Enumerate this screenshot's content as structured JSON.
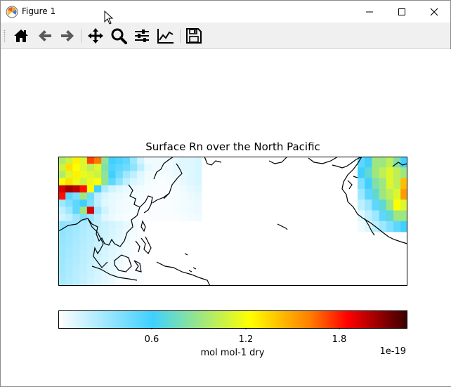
{
  "window": {
    "title": "Figure 1",
    "controls": {
      "minimize": "minimize",
      "maximize": "maximize",
      "close": "close"
    }
  },
  "toolbar": {
    "tools": [
      "home-icon",
      "back-arrow-icon",
      "forward-arrow-icon",
      "pan-move-icon",
      "zoom-magnifier-icon",
      "configure-subplots-icon",
      "edit-axis-icon",
      "save-floppy-icon"
    ]
  },
  "figure": {
    "title": "Surface Rn over the North Pacific",
    "colorbar": {
      "colormap": [
        "#ffffff",
        "#3fd0ff",
        "#ffff00",
        "#ff7f00",
        "#ff0000",
        "#380000"
      ],
      "ticks": [
        "0.6",
        "1.2",
        "1.8"
      ],
      "tick_values": [
        0.6,
        1.2,
        1.8
      ],
      "range": [
        0,
        2.2
      ],
      "label": "mol mol-1 dry",
      "exponent": "1e-19"
    }
  },
  "chart_data": {
    "type": "heatmap",
    "title": "Surface Rn over the North Pacific",
    "colorbar_label": "mol mol-1 dry",
    "colorbar_ticks": [
      0.6,
      1.2,
      1.8
    ],
    "colorbar_exponent": "1e-19",
    "value_range": [
      0,
      2.2
    ],
    "grid_cols": 20,
    "grid_rows": 9,
    "values": [
      [
        0.95,
        1.05,
        1.25,
        1.1,
        1.7,
        1.6,
        0.85,
        0.6,
        0.55,
        0.5,
        0.3,
        0.15,
        0.05,
        0.05,
        0.05,
        0.05,
        0.08,
        0.1,
        0.1,
        0.12
      ],
      [
        1.05,
        1.3,
        1.2,
        1.1,
        1.0,
        1.1,
        0.8,
        0.55,
        0.5,
        0.45,
        0.35,
        0.2,
        0.08,
        0.05,
        0.05,
        0.05,
        0.08,
        0.1,
        0.1,
        0.12
      ],
      [
        0.95,
        1.1,
        1.25,
        1.15,
        1.1,
        1.05,
        0.85,
        0.6,
        0.45,
        0.3,
        0.2,
        0.1,
        0.05,
        0.03,
        0.03,
        0.04,
        0.06,
        0.08,
        0.1,
        0.12
      ],
      [
        1.2,
        1.3,
        1.15,
        1.05,
        1.15,
        1.2,
        0.85,
        0.5,
        0.35,
        0.2,
        0.12,
        0.08,
        0.04,
        0.02,
        0.02,
        0.03,
        0.05,
        0.08,
        0.1,
        0.12
      ],
      [
        1.9,
        2.0,
        1.95,
        1.8,
        1.2,
        0.6,
        0.25,
        0.15,
        0.1,
        0.07,
        0.05,
        0.04,
        0.03,
        0.02,
        0.02,
        0.02,
        0.03,
        0.05,
        0.08,
        0.1
      ],
      [
        1.8,
        0.5,
        0.4,
        0.9,
        0.45,
        0.2,
        0.12,
        0.08,
        0.06,
        0.05,
        0.04,
        0.03,
        0.02,
        0.02,
        0.02,
        0.02,
        0.03,
        0.04,
        0.06,
        0.08
      ],
      [
        0.3,
        0.4,
        0.5,
        0.6,
        0.4,
        0.2,
        0.1,
        0.07,
        0.05,
        0.04,
        0.03,
        0.02,
        0.02,
        0.02,
        0.02,
        0.02,
        0.03,
        0.04,
        0.05,
        0.06
      ],
      [
        0.2,
        0.3,
        0.5,
        0.9,
        1.9,
        0.3,
        0.15,
        0.08,
        0.05,
        0.04,
        0.03,
        0.02,
        0.02,
        0.02,
        0.02,
        0.02,
        0.03,
        0.04,
        0.05,
        0.06
      ],
      [
        0.15,
        0.2,
        0.3,
        0.4,
        0.3,
        0.2,
        0.1,
        0.06,
        0.04,
        0.03,
        0.02,
        0.02,
        0.02,
        0.02,
        0.02,
        0.02,
        0.02,
        0.03,
        0.04,
        0.05
      ]
    ],
    "east_values": [
      [
        0.5,
        0.6,
        0.9,
        0.9,
        1.0,
        0.8,
        0.6
      ],
      [
        0.6,
        0.7,
        0.9,
        1.0,
        1.1,
        1.0,
        0.9
      ],
      [
        0.4,
        0.6,
        0.8,
        0.9,
        1.1,
        1.0,
        1.4
      ],
      [
        0.3,
        0.5,
        0.7,
        0.9,
        1.0,
        1.1,
        1.5
      ],
      [
        0.2,
        0.3,
        0.5,
        0.7,
        0.9,
        1.2,
        1.1
      ],
      [
        0.1,
        0.2,
        0.3,
        0.5,
        0.7,
        0.9,
        0.9
      ],
      [
        0.05,
        0.1,
        0.2,
        0.3,
        0.4,
        0.5,
        0.6
      ]
    ],
    "grid": false
  }
}
